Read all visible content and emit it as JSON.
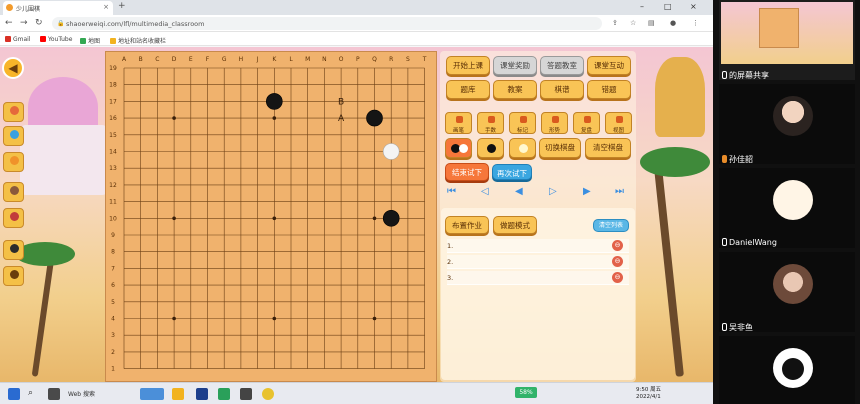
{
  "browser": {
    "tab_title": "少儿围棋",
    "url": "shaoerweiqi.com/lfl/multimedia_classroom",
    "bookmarks": [
      "Gmail",
      "YouTube",
      "地图",
      "地址和站名收藏栏"
    ]
  },
  "board": {
    "columns": [
      "A",
      "B",
      "C",
      "D",
      "E",
      "F",
      "G",
      "H",
      "J",
      "K",
      "L",
      "M",
      "N",
      "O",
      "P",
      "Q",
      "R",
      "S",
      "T"
    ],
    "rows": [
      "19",
      "18",
      "17",
      "16",
      "15",
      "14",
      "13",
      "12",
      "11",
      "10",
      "9",
      "8",
      "7",
      "6",
      "5",
      "4",
      "3",
      "2",
      "1"
    ],
    "stones": [
      {
        "col": "K",
        "row": 17,
        "color": "black"
      },
      {
        "col": "Q",
        "row": 16,
        "color": "black"
      },
      {
        "col": "R",
        "row": 14,
        "color": "white"
      },
      {
        "col": "R",
        "row": 10,
        "color": "black"
      }
    ],
    "marks": [
      {
        "col": "O",
        "row": 17,
        "text": "B"
      },
      {
        "col": "O",
        "row": 16,
        "text": "A"
      }
    ]
  },
  "panel": {
    "top_buttons": [
      {
        "label": "开始上课",
        "style": "orange"
      },
      {
        "label": "课堂奖励",
        "style": "grey"
      },
      {
        "label": "答题教室",
        "style": "grey"
      },
      {
        "label": "课堂互动",
        "style": "orange"
      },
      {
        "label": "题库",
        "style": "orange"
      },
      {
        "label": "教案",
        "style": "orange"
      },
      {
        "label": "棋谱",
        "style": "orange"
      },
      {
        "label": "错题",
        "style": "orange"
      }
    ],
    "tools": [
      "画笔",
      "手数",
      "标记",
      "形势",
      "复盘",
      "视图"
    ],
    "switch_board": "切换棋盘",
    "clear_board": "清空棋盘",
    "end_trial": "结束试下",
    "retry": "再次试下"
  },
  "tasks": {
    "assign_label": "布置作业",
    "mode_label": "做题模式",
    "clear_label": "清空列表",
    "items": [
      "1.",
      "2.",
      "3."
    ]
  },
  "taskbar": {
    "search_label": "Web 搜索",
    "time": "9:50 周五",
    "date": "2022/4/1",
    "battery": "58%"
  },
  "participants": [
    {
      "name": "的屏幕共享",
      "kind": "screen"
    },
    {
      "name": "孙佳韶",
      "kind": "photo"
    },
    {
      "name": "DanielWang",
      "kind": "drawing"
    },
    {
      "name": "吴非鱼",
      "kind": "photo"
    },
    {
      "name": "",
      "kind": "cat"
    }
  ]
}
